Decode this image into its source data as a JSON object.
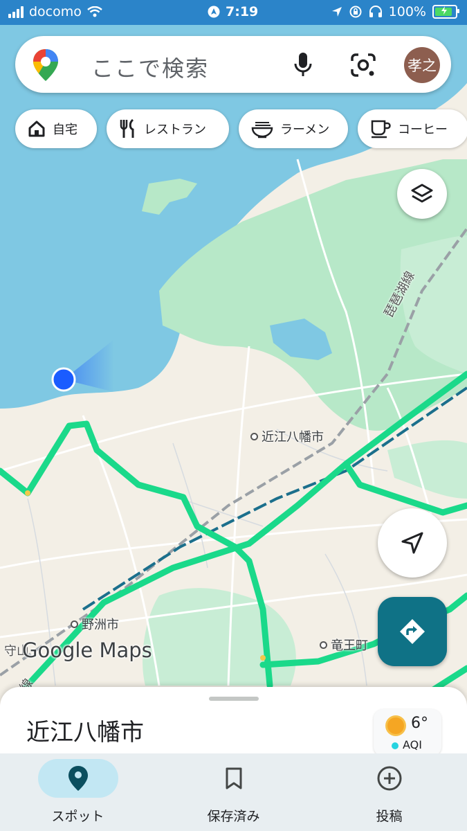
{
  "status_bar": {
    "carrier": "docomo",
    "time": "7:19",
    "battery": "100%",
    "battery_level": 1.0
  },
  "search": {
    "placeholder": "ここで検索",
    "avatar_text": "孝之",
    "icons": [
      "google-maps-pin-icon",
      "microphone-icon",
      "google-lens-icon"
    ]
  },
  "chips": [
    {
      "label": "自宅",
      "icon": "home-icon"
    },
    {
      "label": "レストラン",
      "icon": "restaurant-icon"
    },
    {
      "label": "ラーメン",
      "icon": "ramen-icon"
    },
    {
      "label": "コーヒー",
      "icon": "coffee-icon"
    }
  ],
  "map": {
    "watermark": "Google Maps",
    "labels": {
      "city_main": "近江八幡市",
      "city_yasu": "野洲市",
      "town_ryuo": "竜王町",
      "railway": "琵琶湖線",
      "partial_left": "守山",
      "partial_rail": "線"
    },
    "colors": {
      "water": "#7fc8e3",
      "land": "#f3efe6",
      "park": "#b7e8c8",
      "highway": "#1ad98a",
      "rail": "#1b6f8c",
      "location_dot": "#1a5cff"
    }
  },
  "sheet": {
    "place_title": "近江八幡市",
    "weather_temp": "6°",
    "weather_aqi": "AQI"
  },
  "bottom_nav": [
    {
      "label": "スポット",
      "icon": "location-pin-icon",
      "active": true
    },
    {
      "label": "保存済み",
      "icon": "bookmark-icon",
      "active": false
    },
    {
      "label": "投稿",
      "icon": "add-circle-icon",
      "active": false
    }
  ]
}
